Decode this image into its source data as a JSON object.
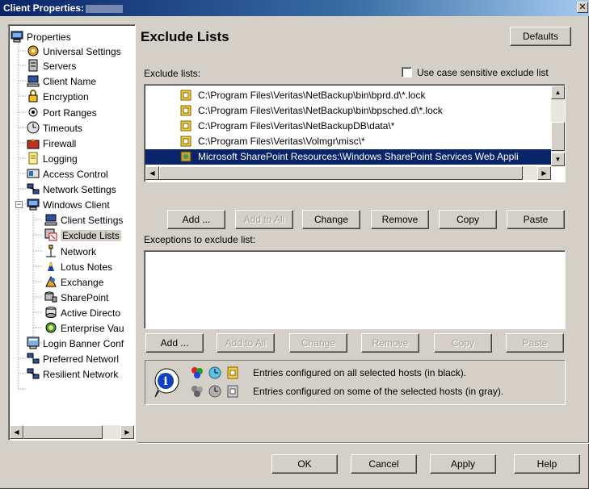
{
  "window": {
    "title": "Client Properties:",
    "close_label": "✕"
  },
  "tree": {
    "items": [
      {
        "label": "Properties",
        "icon": "computer-icon"
      },
      {
        "label": "Universal Settings",
        "icon": "universal-settings-icon"
      },
      {
        "label": "Servers",
        "icon": "servers-icon"
      },
      {
        "label": "Client Name",
        "icon": "client-name-icon"
      },
      {
        "label": "Encryption",
        "icon": "lock-icon"
      },
      {
        "label": "Port Ranges",
        "icon": "port-icon"
      },
      {
        "label": "Timeouts",
        "icon": "clock-icon"
      },
      {
        "label": "Firewall",
        "icon": "firewall-icon"
      },
      {
        "label": "Logging",
        "icon": "log-icon"
      },
      {
        "label": "Access Control",
        "icon": "access-control-icon"
      },
      {
        "label": "Network Settings",
        "icon": "network-icon"
      },
      {
        "label": "Windows Client",
        "icon": "computer-icon"
      },
      {
        "label": "Client Settings",
        "icon": "client-settings-icon"
      },
      {
        "label": "Exclude Lists",
        "icon": "exclude-lists-icon"
      },
      {
        "label": "Network",
        "icon": "network-icon"
      },
      {
        "label": "Lotus Notes",
        "icon": "lotus-icon"
      },
      {
        "label": "Exchange",
        "icon": "exchange-icon"
      },
      {
        "label": "SharePoint",
        "icon": "sharepoint-icon"
      },
      {
        "label": "Active Directo",
        "icon": "directory-icon"
      },
      {
        "label": "Enterprise Vau",
        "icon": "vault-icon"
      },
      {
        "label": "Login Banner Conf",
        "icon": "banner-icon"
      },
      {
        "label": "Preferred Networl",
        "icon": "network-icon"
      },
      {
        "label": "Resilient Network",
        "icon": "network-icon"
      }
    ]
  },
  "main": {
    "heading": "Exclude Lists",
    "defaults_button": "Defaults",
    "exclude_lists_label": "Exclude lists:",
    "case_sensitive_label": "Use case sensitive exclude list",
    "case_sensitive_checked": false,
    "exclude_entries": [
      "C:\\Program Files\\Veritas\\NetBackup\\bin\\bprd.d\\*.lock",
      "C:\\Program Files\\Veritas\\NetBackup\\bin\\bpsched.d\\*.lock",
      "C:\\Program Files\\Veritas\\NetBackupDB\\data\\*",
      "C:\\Program Files\\Veritas\\Volmgr\\misc\\*",
      "Microsoft SharePoint Resources:\\Windows SharePoint Services Web Appli"
    ],
    "selected_entry_index": 4,
    "buttons1": [
      "Add ...",
      "Add to All",
      "Change",
      "Remove",
      "Copy",
      "Paste"
    ],
    "exceptions_label": "Exceptions to exclude list:",
    "buttons2": [
      "Add ...",
      "Add to All",
      "Change",
      "Remove",
      "Copy",
      "Paste"
    ],
    "legend": {
      "black": "Entries configured on all selected hosts (in black).",
      "gray": "Entries configured on some of the selected hosts (in gray)."
    }
  },
  "footer": {
    "ok": "OK",
    "cancel": "Cancel",
    "apply": "Apply",
    "help": "Help"
  },
  "colors": {
    "selection": "#0a246a",
    "face": "#d4d0c8"
  }
}
